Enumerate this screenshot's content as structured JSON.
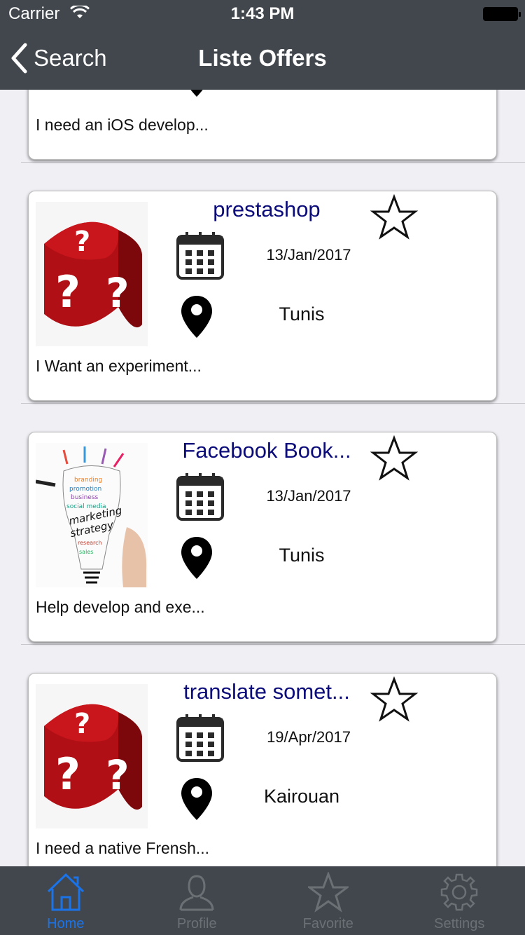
{
  "status": {
    "carrier": "Carrier",
    "time": "1:43 PM"
  },
  "nav": {
    "back_label": "Search",
    "title": "Liste Offers"
  },
  "partial_card": {
    "description": "I need an iOS develop..."
  },
  "offers": [
    {
      "title": "prestashop",
      "date": "13/Jan/2017",
      "city": "Tunis",
      "description": "I Want an experiment...",
      "image": "dice-question-image"
    },
    {
      "title": "Facebook Book...",
      "date": "13/Jan/2017",
      "city": "Tunis",
      "description": "Help develop and exe...",
      "image": "marketing-strategy-image"
    },
    {
      "title": "translate somet...",
      "date": "19/Apr/2017",
      "city": "Kairouan",
      "description": "I need a native Frensh...",
      "image": "dice-question-image"
    }
  ],
  "tabs": [
    {
      "label": "Home",
      "icon": "home-icon",
      "active": true
    },
    {
      "label": "Profile",
      "icon": "profile-icon",
      "active": false
    },
    {
      "label": "Favorite",
      "icon": "star-icon",
      "active": false
    },
    {
      "label": "Settings",
      "icon": "gear-icon",
      "active": false
    }
  ],
  "colors": {
    "bar": "#41474d",
    "title": "#0b0b7a",
    "active_tab": "#1a73e8",
    "background": "#efeff4"
  }
}
